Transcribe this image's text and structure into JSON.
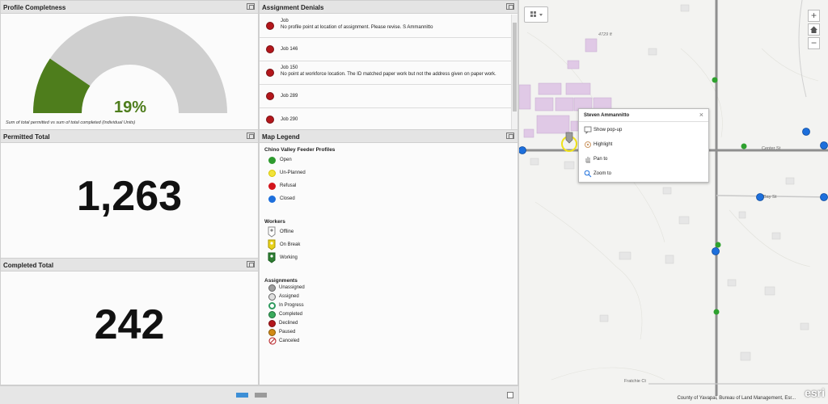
{
  "profile": {
    "title": "Profile Completness",
    "percent": "19%",
    "fraction": 0.19,
    "note": "Sum of total permitted vs sum of total completed (Individual Units)"
  },
  "permitted": {
    "title": "Permitted Total",
    "value": "1,263"
  },
  "completed": {
    "title": "Completed Total",
    "value": "242"
  },
  "denials": {
    "title": "Assignment Denials",
    "items": [
      {
        "title": "Job",
        "desc": "No profile point at location of assignment. Please revise. S Ammannitto"
      },
      {
        "title": "Job 146",
        "desc": ""
      },
      {
        "title": "Job 150",
        "desc": "No point at workforce location. The ID matched paper work but not the address given on paper work."
      },
      {
        "title": "Job 289",
        "desc": ""
      },
      {
        "title": "Job 290",
        "desc": ""
      }
    ]
  },
  "legend": {
    "title": "Map Legend",
    "profiles_heading": "Chino Valley Feeder Profiles",
    "profiles": [
      {
        "label": "Open",
        "color": "#2e9a2e"
      },
      {
        "label": "Un-Planned",
        "color": "#f2e33a"
      },
      {
        "label": "Refusal",
        "color": "#d2141b"
      },
      {
        "label": "Closed",
        "color": "#1d6fdc"
      }
    ],
    "workers_heading": "Workers",
    "workers": [
      {
        "label": "Offline",
        "color": "#9a9a9a"
      },
      {
        "label": "On Break",
        "color": "#e8d21a"
      },
      {
        "label": "Working",
        "color": "#2e7d32"
      }
    ],
    "assignments_heading": "Assignments",
    "assignments": [
      {
        "label": "Unassigned",
        "color": "#9e9e9e"
      },
      {
        "label": "Assigned",
        "color": "#bdbdbd"
      },
      {
        "label": "In Progress",
        "color": "#2e9a5e"
      },
      {
        "label": "Completed",
        "color": "#3aaa5c"
      },
      {
        "label": "Declined",
        "color": "#b3161b"
      },
      {
        "label": "Paused",
        "color": "#d28a16"
      },
      {
        "label": "Canceled",
        "color": "#b3161b"
      }
    ]
  },
  "map": {
    "popup": {
      "name": "Steven Ammannitto",
      "actions": [
        "Show pop-up",
        "Highlight",
        "Pan to",
        "Zoom to"
      ]
    },
    "labels": {
      "elevation": "4729 ft",
      "street1": "Center St",
      "street2": "Bay St",
      "street3": "Fratchie Ct"
    },
    "attribution": "County of Yavapai, Bureau of Land Management, Esr...",
    "logo": "esri"
  }
}
